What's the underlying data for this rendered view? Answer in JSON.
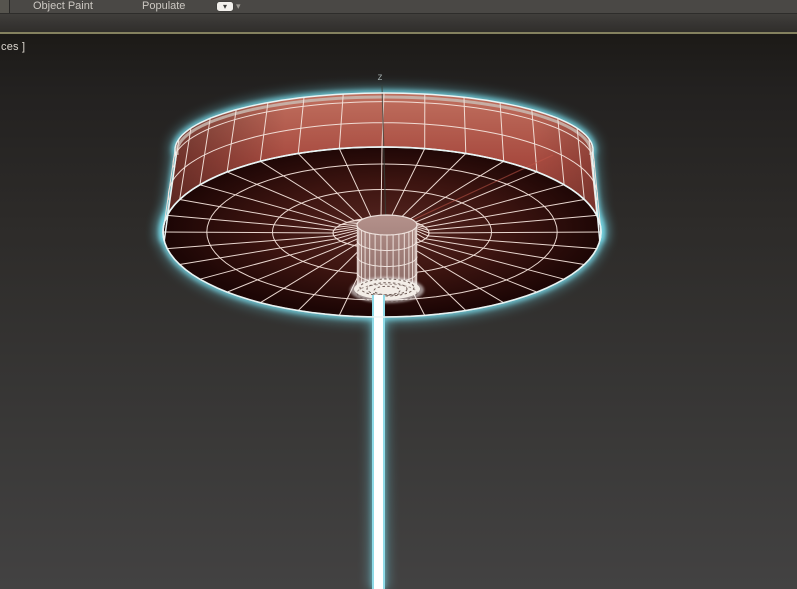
{
  "ribbon": {
    "tabs": [
      {
        "label": "Object Paint"
      },
      {
        "label": "Populate"
      }
    ],
    "minimize_icon": "▾",
    "options_caret_icon": "▾"
  },
  "viewport": {
    "label_fragment": "ces ]",
    "axis_label": "z"
  },
  "colors": {
    "selection_glow": "#76d7e6",
    "outline_white": "#e9f4f4",
    "band_top": "#c0705f",
    "band_mid": "#a84b40",
    "band_bottom": "#7d332c",
    "band_highlight": "#c9bab2",
    "face_center": "#552520",
    "face_mid": "#3c1410",
    "face_edge": "#1d0605",
    "wire": "#f3e2da",
    "hub_light": "#b4918b",
    "hub_dark": "#876762",
    "cap_white": "#f3ede7",
    "cap_dash": "#5f4b46",
    "pole_core": "#ffffff",
    "pole_edge": "#8fdbe8",
    "axis_red": "#c05548",
    "axis_z_line": "#38433c",
    "axis_label_gray": "#9aa4a4",
    "olive_rule": "#84815f"
  }
}
